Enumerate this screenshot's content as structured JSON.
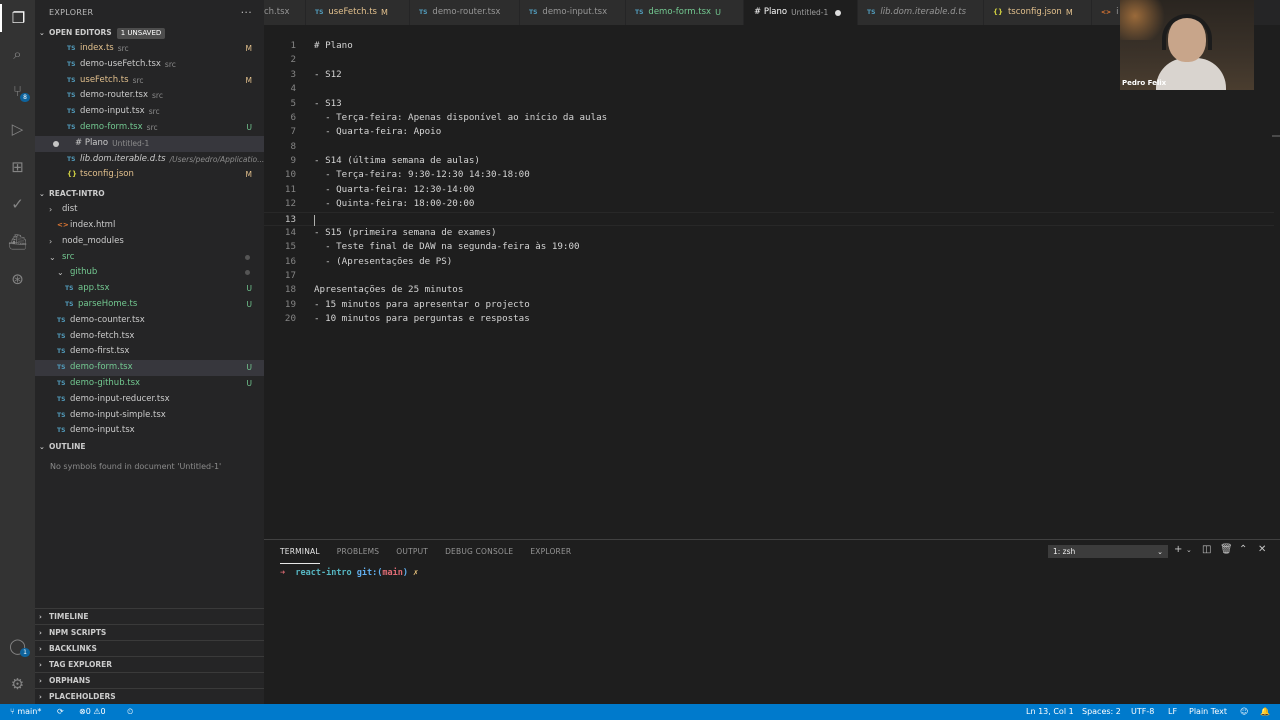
{
  "activity": {
    "scm_badge": "8",
    "accounts_badge": "1"
  },
  "sidebar": {
    "title": "EXPLORER",
    "more": "···",
    "open_editors": {
      "label": "OPEN EDITORS",
      "unsaved": "1 UNSAVED",
      "items": [
        {
          "icon": "TS",
          "name": "index.ts",
          "desc": "src",
          "status": "M"
        },
        {
          "icon": "TS",
          "name": "demo-useFetch.tsx",
          "desc": "src",
          "status": ""
        },
        {
          "icon": "TS",
          "name": "useFetch.ts",
          "desc": "src",
          "status": "M"
        },
        {
          "icon": "TS",
          "name": "demo-router.tsx",
          "desc": "src",
          "status": ""
        },
        {
          "icon": "TS",
          "name": "demo-input.tsx",
          "desc": "src",
          "status": ""
        },
        {
          "icon": "TS",
          "name": "demo-form.tsx",
          "desc": "src",
          "status": "U"
        },
        {
          "icon": "#",
          "name": "# Plano",
          "desc": "Untitled-1",
          "status": ""
        },
        {
          "icon": "TS",
          "name": "lib.dom.iterable.d.ts",
          "desc": "/Users/pedro/Applicatio...",
          "status": ""
        },
        {
          "icon": "{}",
          "name": "tsconfig.json",
          "desc": "",
          "status": "M"
        }
      ]
    },
    "project": {
      "label": "REACT-INTRO",
      "items": [
        {
          "indent": 1,
          "icon": "›",
          "name": "dist",
          "status": ""
        },
        {
          "indent": 2,
          "icon": "<>",
          "name": "index.html",
          "status": ""
        },
        {
          "indent": 1,
          "icon": "›",
          "name": "node_modules",
          "status": ""
        },
        {
          "indent": 1,
          "icon": "⌄",
          "name": "src",
          "status": "dot"
        },
        {
          "indent": 2,
          "icon": "⌄",
          "name": "github",
          "status": "dot"
        },
        {
          "indent": 3,
          "icon": "TS",
          "name": "app.tsx",
          "status": "U"
        },
        {
          "indent": 3,
          "icon": "TS",
          "name": "parseHome.ts",
          "status": "U"
        },
        {
          "indent": 2,
          "icon": "TS",
          "name": "demo-counter.tsx",
          "status": ""
        },
        {
          "indent": 2,
          "icon": "TS",
          "name": "demo-fetch.tsx",
          "status": ""
        },
        {
          "indent": 2,
          "icon": "TS",
          "name": "demo-first.tsx",
          "status": ""
        },
        {
          "indent": 2,
          "icon": "TS",
          "name": "demo-form.tsx",
          "status": "U"
        },
        {
          "indent": 2,
          "icon": "TS",
          "name": "demo-github.tsx",
          "status": "U"
        },
        {
          "indent": 2,
          "icon": "TS",
          "name": "demo-input-reducer.tsx",
          "status": ""
        },
        {
          "indent": 2,
          "icon": "TS",
          "name": "demo-input-simple.tsx",
          "status": ""
        },
        {
          "indent": 2,
          "icon": "TS",
          "name": "demo-input.tsx",
          "status": ""
        }
      ]
    },
    "outline": {
      "label": "OUTLINE",
      "message": "No symbols found in document 'Untitled-1'"
    },
    "bottom_sections": [
      "TIMELINE",
      "NPM SCRIPTS",
      "BACKLINKS",
      "TAG EXPLORER",
      "ORPHANS",
      "PLACEHOLDERS"
    ]
  },
  "tabs": [
    {
      "icon": "",
      "label": "ch.tsx",
      "desc": "",
      "status": ""
    },
    {
      "icon": "TS",
      "label": "useFetch.ts",
      "desc": "",
      "status": "M"
    },
    {
      "icon": "TS",
      "label": "demo-router.tsx",
      "desc": "",
      "status": ""
    },
    {
      "icon": "TS",
      "label": "demo-input.tsx",
      "desc": "",
      "status": ""
    },
    {
      "icon": "TS",
      "label": "demo-form.tsx",
      "desc": "",
      "status": "U"
    },
    {
      "icon": "#",
      "label": "# Plano",
      "desc": "Untitled-1",
      "status": "dot"
    },
    {
      "icon": "TS",
      "label": "lib.dom.iterable.d.ts",
      "desc": "",
      "status": ""
    },
    {
      "icon": "{}",
      "label": "tsconfig.json",
      "desc": "",
      "status": "M"
    },
    {
      "icon": "<>",
      "label": "i",
      "desc": "",
      "status": ""
    }
  ],
  "editor": {
    "current_line": 13,
    "lines": [
      "# Plano",
      "",
      "- S12",
      "",
      "- S13",
      "  - Terça-feira: Apenas disponível ao início da aulas",
      "  - Quarta-feira: Apoio",
      "",
      "- S14 (última semana de aulas)",
      "  - Terça-feira: 9:30-12:30 14:30-18:00",
      "  - Quarta-feira: 12:30-14:00",
      "  - Quinta-feira: 18:00-20:00",
      "",
      "- S15 (primeira semana de exames)",
      "  - Teste final de DAW na segunda-feira às 19:00",
      "  - (Apresentações de PS)",
      "",
      "Apresentações de 25 minutos",
      "- 15 minutos para apresentar o projecto",
      "- 10 minutos para perguntas e respostas"
    ]
  },
  "webcam": {
    "name": "Pedro Felix"
  },
  "panel": {
    "tabs": [
      "TERMINAL",
      "PROBLEMS",
      "OUTPUT",
      "DEBUG CONSOLE",
      "EXPLORER"
    ],
    "active_tab": "TERMINAL",
    "terminal_select": "1: zsh",
    "prompt": {
      "arrow": "➜",
      "dir": "react-intro",
      "git": "git:(",
      "branch": "main",
      "git_close": ")",
      "mark": "✗"
    }
  },
  "status": {
    "branch": "main*",
    "errors": "0",
    "warnings": "0",
    "position": "Ln 13, Col 1",
    "spaces": "Spaces: 2",
    "encoding": "UTF-8",
    "eol": "LF",
    "language": "Plain Text"
  },
  "colors": {
    "status_bar": "#007acc",
    "modified": "#e2c08d",
    "untracked": "#73c991",
    "ts_icon": "#519aba"
  }
}
